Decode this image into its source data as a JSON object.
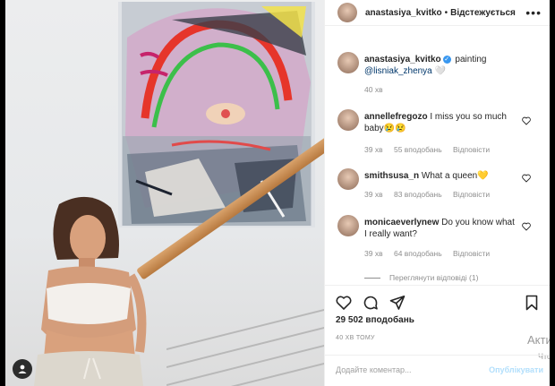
{
  "post": {
    "username": "anastasiya_kvitko",
    "follow_state": "Відстежується",
    "caption_action": "painting",
    "caption_mention": "@lisniak_zhenya",
    "caption_time": "40 хв"
  },
  "comments": [
    {
      "username": "annellefregozo",
      "text": "I miss you so much baby😢😢",
      "time": "39 хв",
      "likes": "55 вподобань",
      "reply": "Відповісти"
    },
    {
      "username": "smithsusa_n",
      "text": "What a queen💛",
      "time": "39 хв",
      "likes": "83 вподобань",
      "reply": "Відповісти"
    },
    {
      "username": "monicaeverlynew",
      "text": "Do you know what I really want?",
      "time": "39 хв",
      "likes": "64 вподобань",
      "reply": "Відповісти"
    }
  ],
  "view_replies": "Переглянути відповіді (1)",
  "likes_total": "29 502 вподобань",
  "posted_ago": "40 ХВ ТОМУ",
  "comment_input": {
    "placeholder": "Додайте коментар...",
    "publish_label": "Опублікувати"
  },
  "watermark": {
    "line1": "Активац",
    "line2": "Чтобы акт"
  },
  "icons": [
    "heart-icon",
    "comment-icon",
    "share-icon",
    "bookmark-icon",
    "more-icon",
    "user-tag-icon",
    "verified-icon"
  ],
  "colors": {
    "text": "#262626",
    "muted": "#8e8e8e",
    "link": "#00376b",
    "verified": "#3897f0",
    "publish": "#b2dffc"
  }
}
